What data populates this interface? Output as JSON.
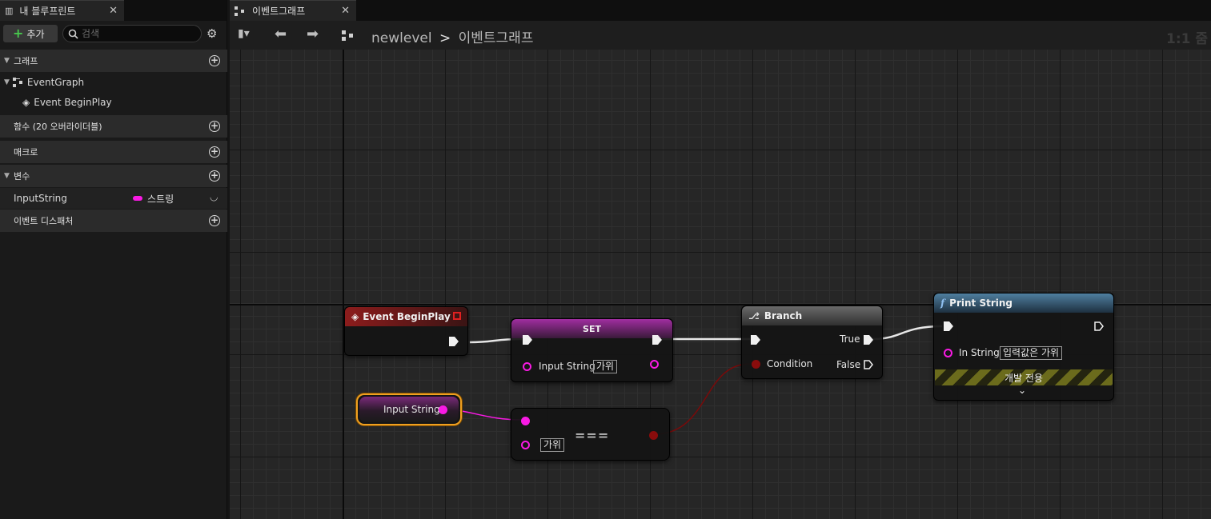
{
  "left_panel": {
    "tab_title": "내 블루프린트",
    "add_label": "추가",
    "search_placeholder": "검색",
    "sections": {
      "graphs": "그래프",
      "functions": "함수 (20 오버라이더블)",
      "macros": "매크로",
      "variables": "변수",
      "event_dispatchers": "이벤트 디스패처"
    },
    "tree": {
      "event_graph": "EventGraph",
      "begin_play": "Event BeginPlay"
    },
    "variable": {
      "name": "InputString",
      "type": "스트링",
      "type_color": "#f91ae4"
    }
  },
  "graph_panel": {
    "tab_title": "이벤트그래프",
    "breadcrumb": {
      "level": "newlevel",
      "separator": ">",
      "graph": "이벤트그래프"
    },
    "zoom": "1:1 줌"
  },
  "nodes": {
    "begin_play": {
      "title": "Event BeginPlay",
      "header_color": "#7a1a1a"
    },
    "set": {
      "title": "SET",
      "pin_label": "Input String",
      "pin_value": "가위",
      "header_color": "#7a2a7a"
    },
    "get": {
      "label": "Input String"
    },
    "equal": {
      "symbol": "===",
      "pin_value": "가위"
    },
    "branch": {
      "title": "Branch",
      "true_label": "True",
      "false_label": "False",
      "condition_label": "Condition",
      "header_color": "#555555"
    },
    "print": {
      "title": "Print String",
      "pin_label": "In String",
      "pin_value": "입력값은 가위",
      "dev_label": "개발 전용",
      "header_color": "#3d6480"
    }
  }
}
